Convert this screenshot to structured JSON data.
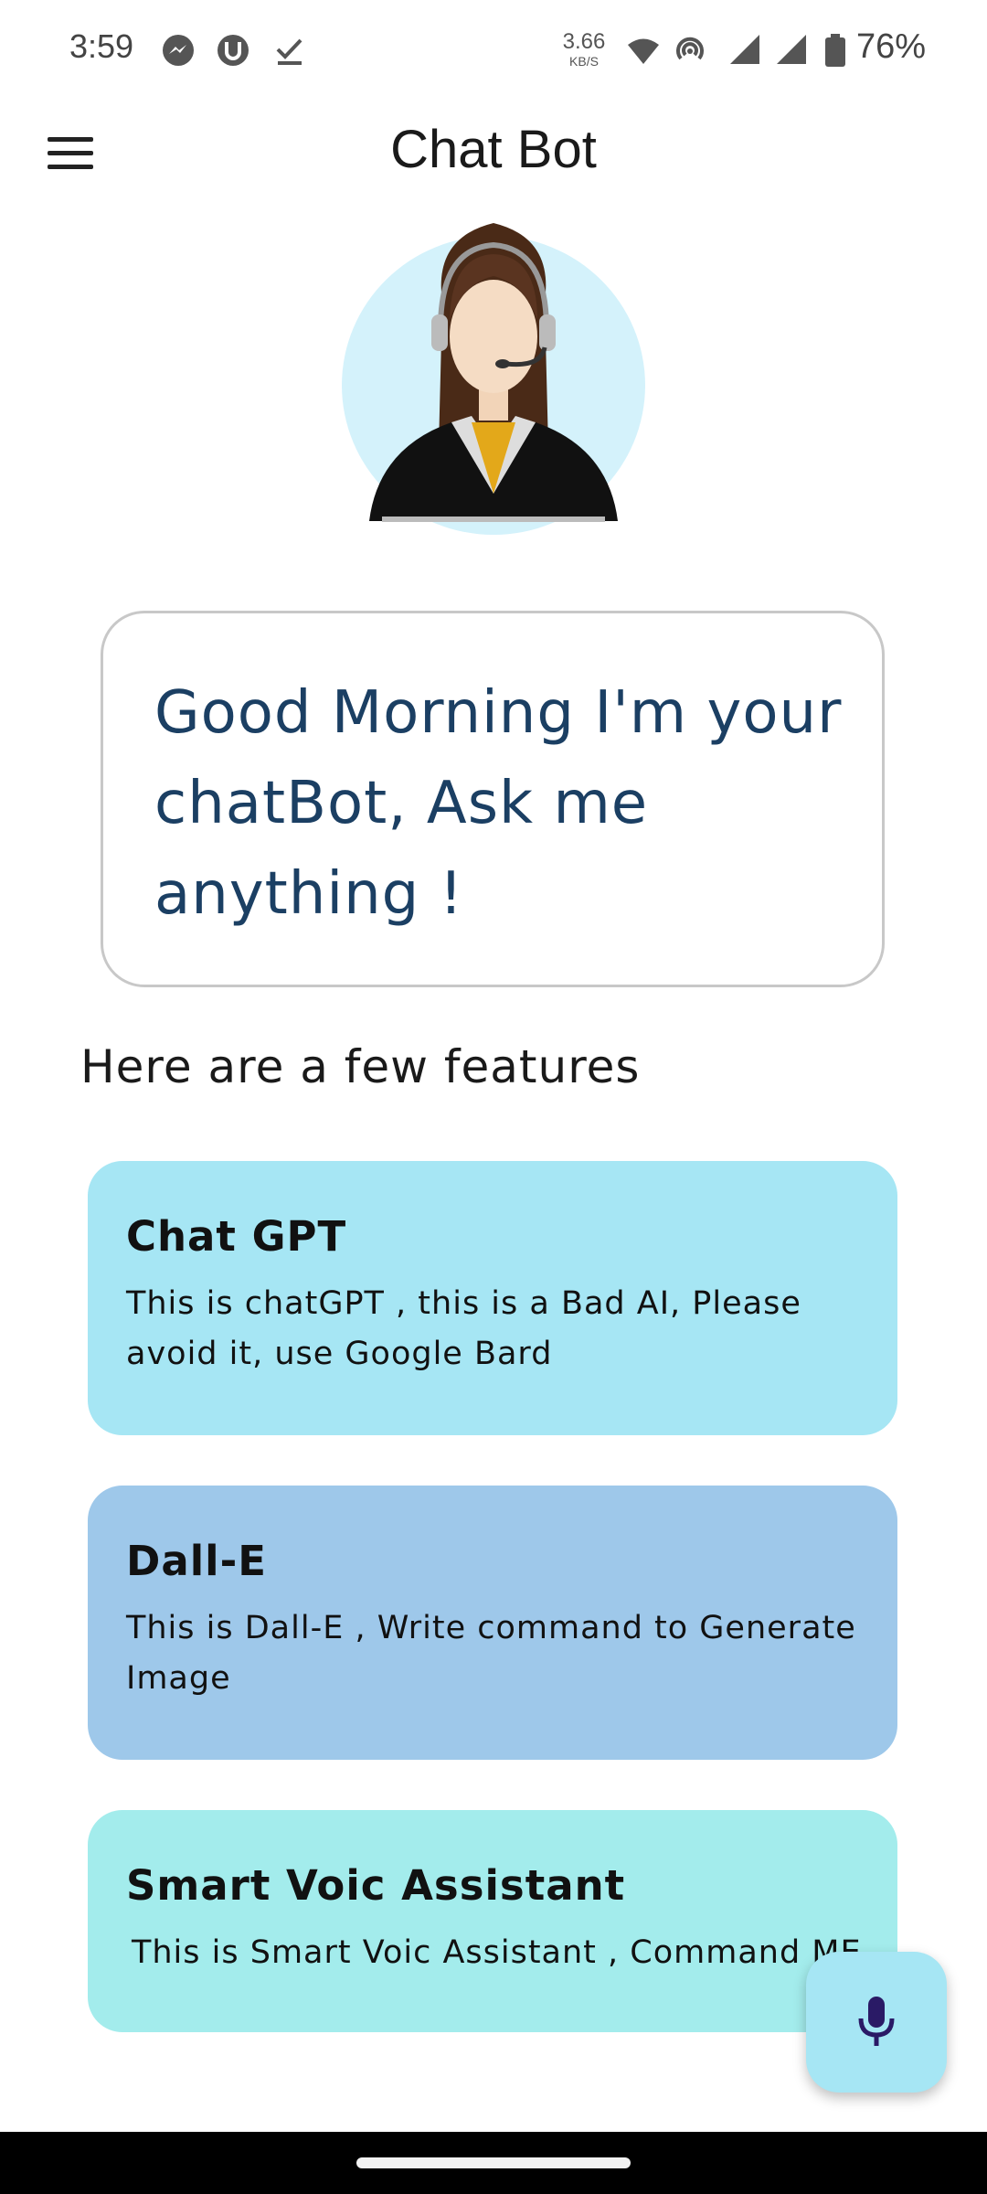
{
  "status_bar": {
    "time": "3:59",
    "net_speed_value": "3.66",
    "net_speed_unit": "KB/S",
    "battery_percent": "76%",
    "icons": [
      "messenger-icon",
      "u-app-icon",
      "check-icon",
      "wifi-icon",
      "hotspot-icon",
      "signal-icon",
      "signal-icon",
      "battery-icon"
    ]
  },
  "app_bar": {
    "title": "Chat Bot",
    "menu_icon": "hamburger-menu-icon"
  },
  "greeting": {
    "text": "Good Morning I'm your chatBot, Ask me anything !"
  },
  "features": {
    "heading": "Here are a few features",
    "cards": [
      {
        "title": "Chat GPT",
        "description": "This is chatGPT , this is a Bad AI, Please avoid it, use Google Bard",
        "color": "#a6e6f4"
      },
      {
        "title": "Dall-E",
        "description": "This is Dall-E , Write command to Generate Image",
        "color": "#9ec8ea"
      },
      {
        "title": "Smart Voic Assistant",
        "description": "This is Smart Voic Assistant , Command ME",
        "color": "#a3ecec"
      }
    ]
  },
  "fab": {
    "icon": "microphone-icon",
    "color": "#a6e6f4",
    "icon_color": "#2a1a66"
  },
  "colors": {
    "greeting_text": "#1b3f63",
    "avatar_bg": "#d4f2fb"
  }
}
